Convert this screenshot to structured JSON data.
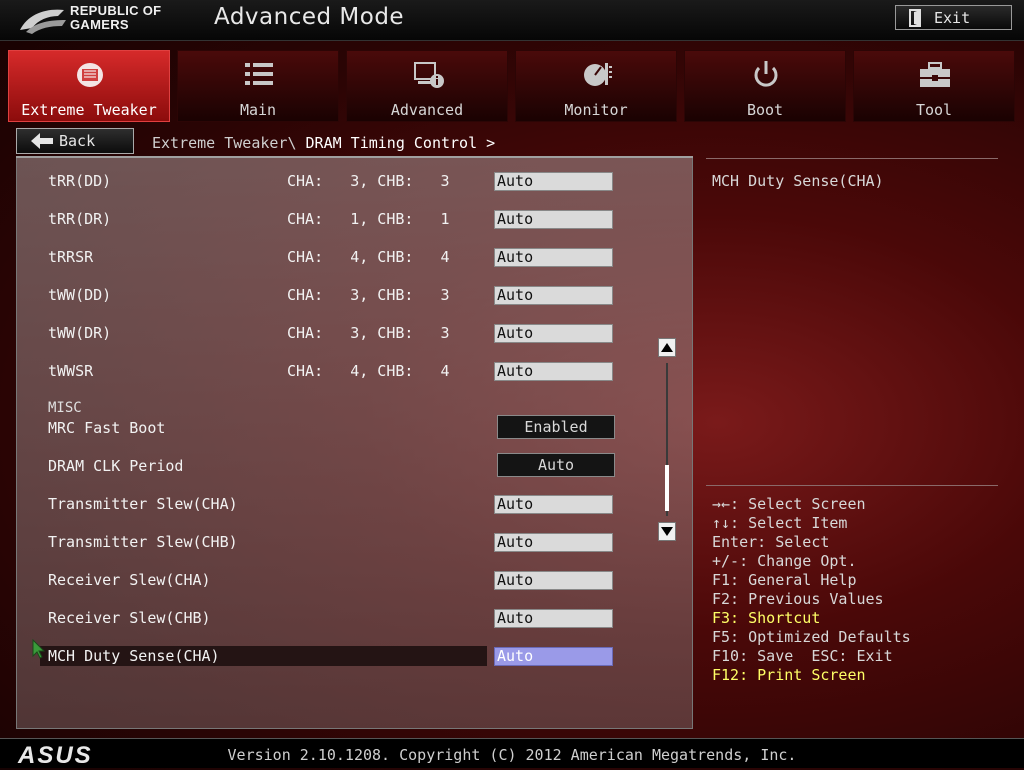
{
  "header": {
    "brand_line1": "REPUBLIC OF",
    "brand_line2": "GAMERS",
    "mode_title": "Advanced Mode",
    "exit_label": "Exit"
  },
  "tabs": [
    {
      "label": "Extreme Tweaker",
      "icon": "extreme-tweaker-icon",
      "active": true
    },
    {
      "label": "Main",
      "icon": "list-icon",
      "active": false
    },
    {
      "label": "Advanced",
      "icon": "advanced-info-icon",
      "active": false
    },
    {
      "label": "Monitor",
      "icon": "gauge-icon",
      "active": false
    },
    {
      "label": "Boot",
      "icon": "power-icon",
      "active": false
    },
    {
      "label": "Tool",
      "icon": "toolbox-icon",
      "active": false
    }
  ],
  "nav": {
    "back_label": "Back",
    "breadcrumb_parent": "Extreme Tweaker\\",
    "breadcrumb_current": "DRAM Timing Control >"
  },
  "settings": [
    {
      "label": "tRR(DD)",
      "cha": "CHA:   3, CHB:   3",
      "value": "Auto"
    },
    {
      "label": "tRR(DR)",
      "cha": "CHA:   1, CHB:   1",
      "value": "Auto"
    },
    {
      "label": "tRRSR",
      "cha": "CHA:   4, CHB:   4",
      "value": "Auto"
    },
    {
      "label": "tWW(DD)",
      "cha": "CHA:   3, CHB:   3",
      "value": "Auto"
    },
    {
      "label": "tWW(DR)",
      "cha": "CHA:   3, CHB:   3",
      "value": "Auto"
    },
    {
      "label": "tWWSR",
      "cha": "CHA:   4, CHB:   4",
      "value": "Auto"
    }
  ],
  "misc_header": "MISC",
  "misc_settings": [
    {
      "label": "MRC Fast Boot",
      "value": "Enabled"
    },
    {
      "label": "DRAM CLK Period",
      "value": "Auto"
    }
  ],
  "slew_settings": [
    {
      "label": "Transmitter Slew(CHA)",
      "value": "Auto"
    },
    {
      "label": "Transmitter Slew(CHB)",
      "value": "Auto"
    },
    {
      "label": "Receiver Slew(CHA)",
      "value": "Auto"
    },
    {
      "label": "Receiver Slew(CHB)",
      "value": "Auto"
    },
    {
      "label": "MCH Duty Sense(CHA)",
      "value": "Auto",
      "selected": true
    }
  ],
  "help": {
    "title": "MCH Duty Sense(CHA)"
  },
  "keys": [
    {
      "text": "→←: Select Screen",
      "highlight": false
    },
    {
      "text": "↑↓: Select Item",
      "highlight": false
    },
    {
      "text": "Enter: Select",
      "highlight": false
    },
    {
      "text": "+/-: Change Opt.",
      "highlight": false
    },
    {
      "text": "F1: General Help",
      "highlight": false
    },
    {
      "text": "F2: Previous Values",
      "highlight": false
    },
    {
      "text": "F3: Shortcut",
      "highlight": true
    },
    {
      "text": "F5: Optimized Defaults",
      "highlight": false
    },
    {
      "text": "F10: Save  ESC: Exit",
      "highlight": false
    },
    {
      "text": "F12: Print Screen",
      "highlight": true
    }
  ],
  "footer": {
    "brand": "ASUS",
    "version": "Version 2.10.1208. Copyright (C) 2012 American Megatrends, Inc."
  },
  "colors": {
    "accent_red": "#d62a2a",
    "highlight_yellow": "#ffff66",
    "selected_value": "#9a9ae8"
  }
}
